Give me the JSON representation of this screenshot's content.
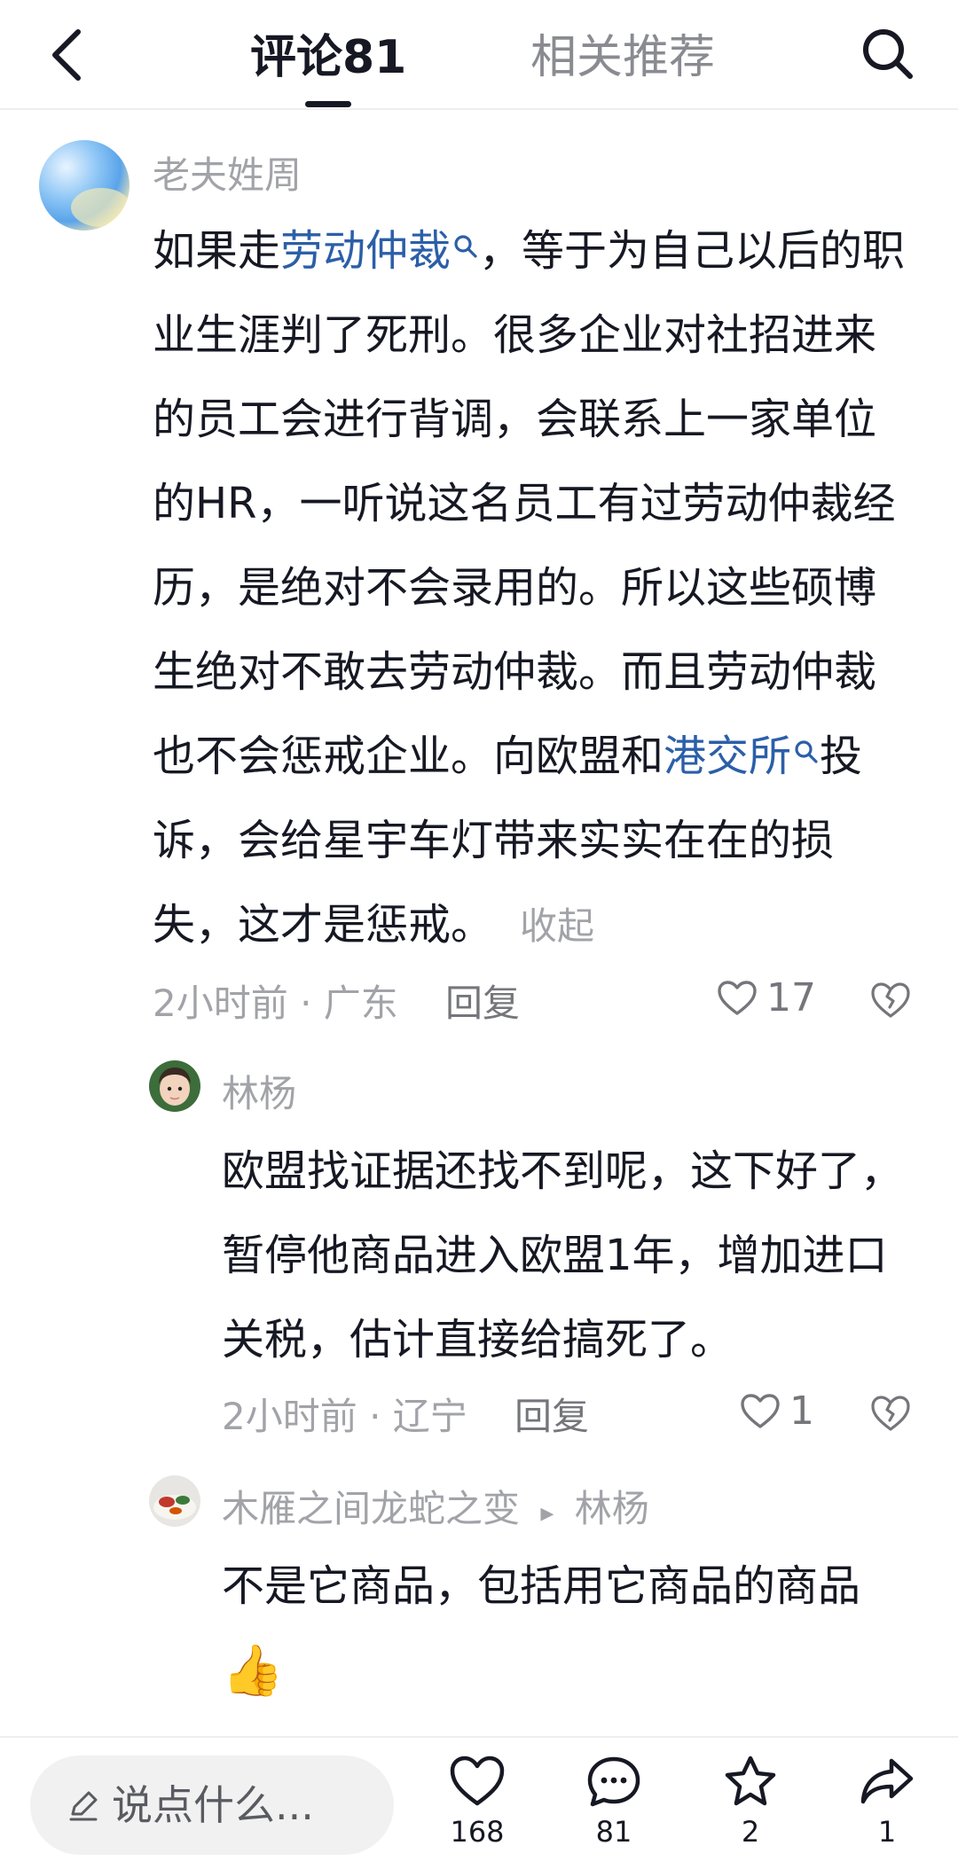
{
  "header": {
    "tab_comments": "评论81",
    "tab_related": "相关推荐"
  },
  "main_comment": {
    "username": "老夫姓周",
    "text_pre": "如果走",
    "keyword1": "劳动仲裁",
    "text_mid": "，等于为自己以后的职业生涯判了死刑。很多企业对社招进来的员工会进行背调，会联系上一家单位的HR，一听说这名员工有过劳动仲裁经历，是绝对不会录用的。所以这些硕博生绝对不敢去劳动仲裁。而且劳动仲裁也不会惩戒企业。向欧盟和",
    "keyword2": "港交所",
    "text_post": "投诉，会给星宇车灯带来实实在在的损失，这才是惩戒。",
    "collapse": "收起",
    "meta": "2小时前 · 广东",
    "reply": "回复",
    "likes": "17"
  },
  "reply1": {
    "username": "林杨",
    "text": "欧盟找证据还找不到呢，这下好了，暂停他商品进入欧盟1年，增加进口关税，估计直接给搞死了。",
    "meta": "2小时前 · 辽宁",
    "reply": "回复",
    "likes": "1"
  },
  "reply2": {
    "username": "木雁之间龙蛇之变",
    "arrow": "▸",
    "reply_to": "林杨",
    "text": "不是它商品，包括用它商品的商品",
    "emoji": "👍"
  },
  "bottom": {
    "input_placeholder": "说点什么...",
    "like_count": "168",
    "comment_count": "81",
    "favorite_count": "2",
    "share_count": "1"
  },
  "colors": {
    "keyword": "#2b5fa8",
    "secondary_text": "#a2a3a8",
    "primary_text": "#161823"
  },
  "icons": [
    "back-arrow-icon",
    "search-icon",
    "search-keyword-icon",
    "heart-icon",
    "broken-heart-icon",
    "pencil-icon",
    "comment-icon",
    "star-icon",
    "share-icon"
  ]
}
